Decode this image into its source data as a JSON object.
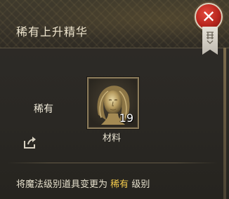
{
  "header": {
    "title": "稀有上升精华"
  },
  "close_button": {
    "icon": "close-icon"
  },
  "rarity": {
    "label": "稀有"
  },
  "item": {
    "icon": "goddess-face-icon",
    "count": "19",
    "label": "材料"
  },
  "share": {
    "icon": "share-icon"
  },
  "description": {
    "prefix": "将魔法级别道具变更为",
    "highlight": "稀有",
    "suffix": "级别"
  },
  "colors": {
    "title": "#efe6cf",
    "highlight": "#f2c94c",
    "close_button": "#c0281e"
  }
}
